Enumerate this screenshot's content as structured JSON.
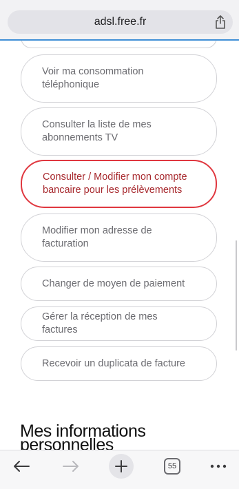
{
  "browser": {
    "url": "adsl.free.fr",
    "tab_count": "55"
  },
  "menu": {
    "items": [
      {
        "label": ""
      },
      {
        "label": "Voir ma consommation téléphonique"
      },
      {
        "label": "Consulter la liste de mes abonnements TV"
      },
      {
        "label": "Consulter / Modifier mon compte bancaire pour les prélèvements"
      },
      {
        "label": "Modifier mon adresse de facturation"
      },
      {
        "label": "Changer de moyen de paiement"
      },
      {
        "label": "Gérer la réception de mes factures"
      },
      {
        "label": "Recevoir un duplicata de facture"
      }
    ],
    "selected_index": 3
  },
  "section": {
    "title": "Mes informations personnelles"
  },
  "colors": {
    "accent_red": "#e0373f",
    "progress_blue": "#3f8fd6"
  },
  "icons": {
    "share": "share-icon",
    "back": "back-arrow-icon",
    "forward": "forward-arrow-icon",
    "new_tab": "plus-icon",
    "tabs": "tabs-icon",
    "more": "more-icon"
  }
}
